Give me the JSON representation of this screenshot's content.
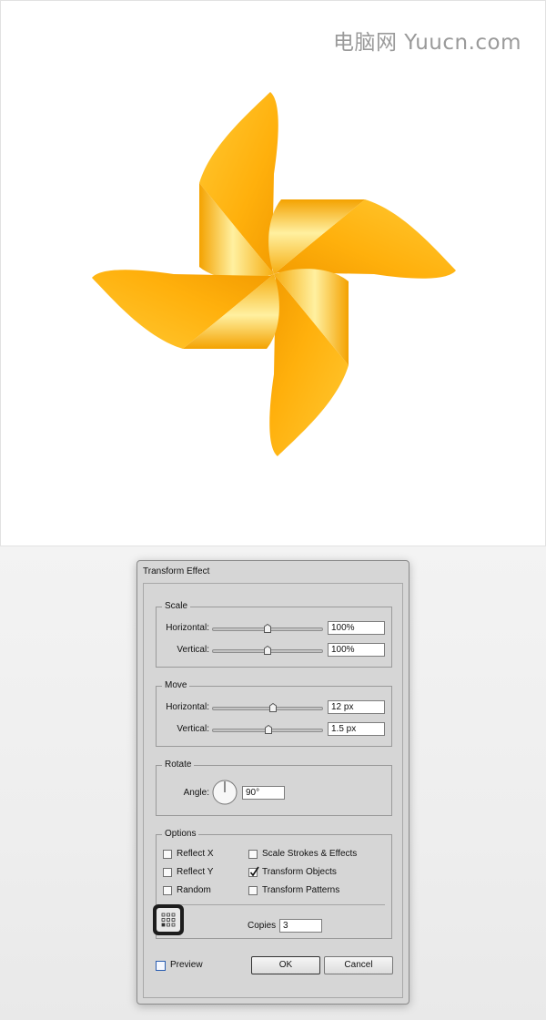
{
  "watermark": "电脑网 Yuucn.com",
  "artwork": {
    "name": "pinwheel",
    "colors": {
      "light": "#ffc933",
      "mid": "#ffb00c",
      "dark": "#f29a00",
      "highlight": "#fff0a0"
    }
  },
  "dialog": {
    "title": "Transform Effect",
    "scale": {
      "label": "Scale",
      "horizontal_label": "Horizontal:",
      "horizontal_value": "100%",
      "vertical_label": "Vertical:",
      "vertical_value": "100%"
    },
    "move": {
      "label": "Move",
      "horizontal_label": "Horizontal:",
      "horizontal_value": "12 px",
      "vertical_label": "Vertical:",
      "vertical_value": "1.5 px"
    },
    "rotate": {
      "label": "Rotate",
      "angle_label": "Angle:",
      "angle_value": "90°"
    },
    "options": {
      "label": "Options",
      "reflect_x": {
        "label": "Reflect X",
        "checked": false
      },
      "reflect_y": {
        "label": "Reflect Y",
        "checked": false
      },
      "random": {
        "label": "Random",
        "checked": false
      },
      "scale_strokes": {
        "label": "Scale Strokes & Effects",
        "checked": false
      },
      "transform_objects": {
        "label": "Transform Objects",
        "checked": true
      },
      "transform_patterns": {
        "label": "Transform Patterns",
        "checked": false
      },
      "copies_label": "Copies",
      "copies_value": "3"
    },
    "preview": {
      "label": "Preview",
      "checked": false
    },
    "ok_label": "OK",
    "cancel_label": "Cancel"
  }
}
